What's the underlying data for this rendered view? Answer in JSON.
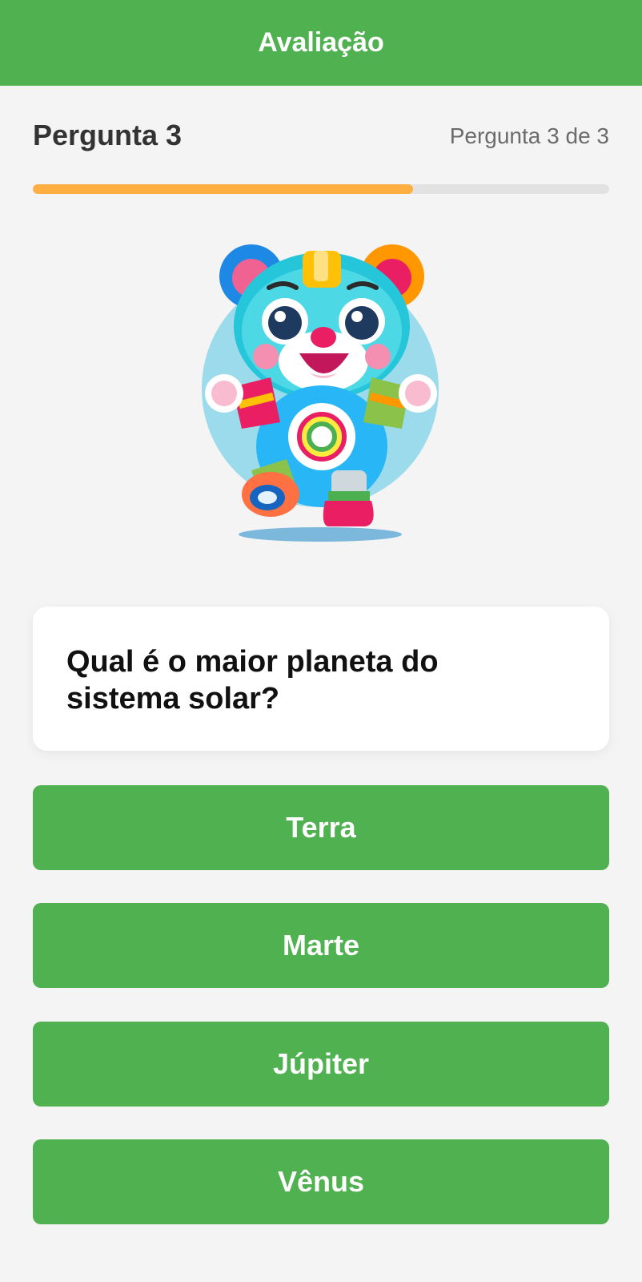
{
  "header": {
    "title": "Avaliação"
  },
  "quiz": {
    "heading": "Pergunta 3",
    "counter": "Pergunta 3 de 3",
    "progress_percent": 66,
    "question": "Qual é o maior planeta do sistema solar?",
    "answers": [
      "Terra",
      "Marte",
      "Júpiter",
      "Vênus"
    ]
  },
  "illustration": {
    "icon": "robot-bear-mascot-icon"
  },
  "colors": {
    "primary": "#4fb150",
    "progress": "#ffae42",
    "background": "#f4f4f4"
  }
}
